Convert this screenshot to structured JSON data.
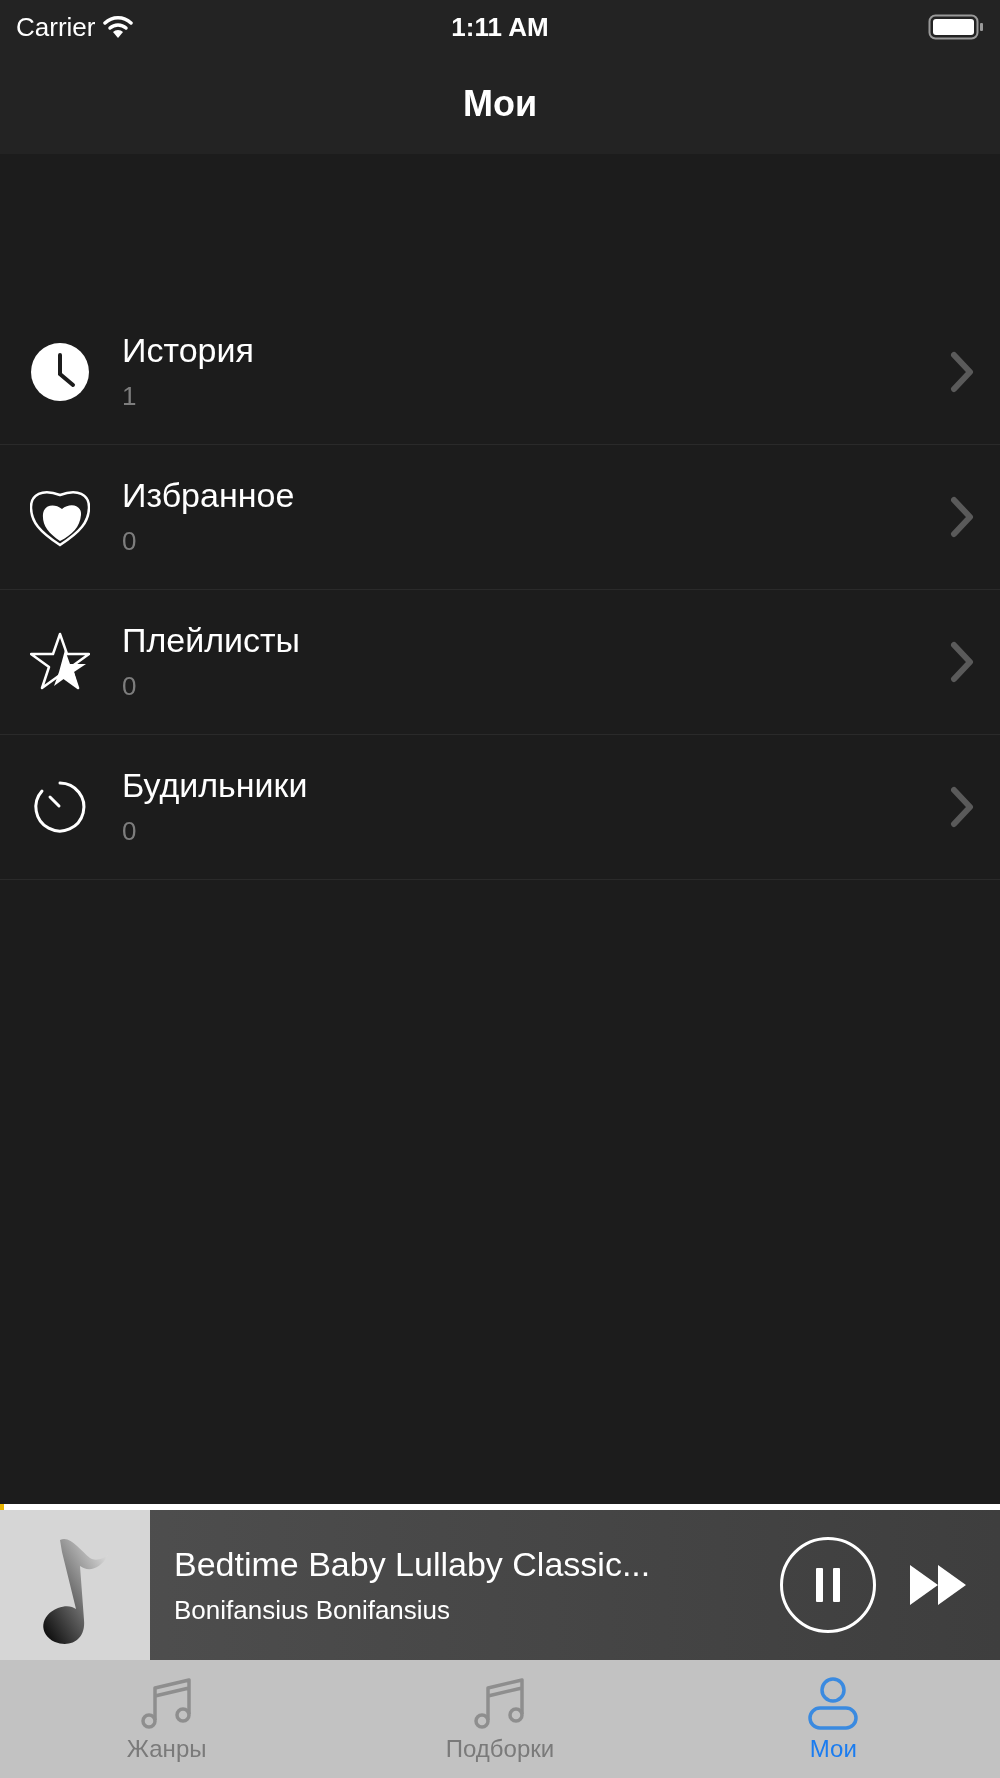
{
  "status_bar": {
    "carrier": "Carrier",
    "time": "1:11 AM"
  },
  "nav_bar": {
    "title": "Мои"
  },
  "items": [
    {
      "kind": "history",
      "title": "История",
      "count": "1"
    },
    {
      "kind": "favorites",
      "title": "Избранное",
      "count": "0"
    },
    {
      "kind": "playlists",
      "title": "Плейлисты",
      "count": "0"
    },
    {
      "kind": "alarms",
      "title": "Будильники",
      "count": "0"
    }
  ],
  "player": {
    "title": "Bedtime Baby Lullaby Classic...",
    "artist": "Bonifansius Bonifansius",
    "playing": true,
    "level": 0.004
  },
  "tabs": [
    {
      "kind": "genres",
      "label": "Жанры",
      "selected": false
    },
    {
      "kind": "collections",
      "label": "Подборки",
      "selected": false
    },
    {
      "kind": "mine",
      "label": "Мои",
      "selected": true
    }
  ]
}
